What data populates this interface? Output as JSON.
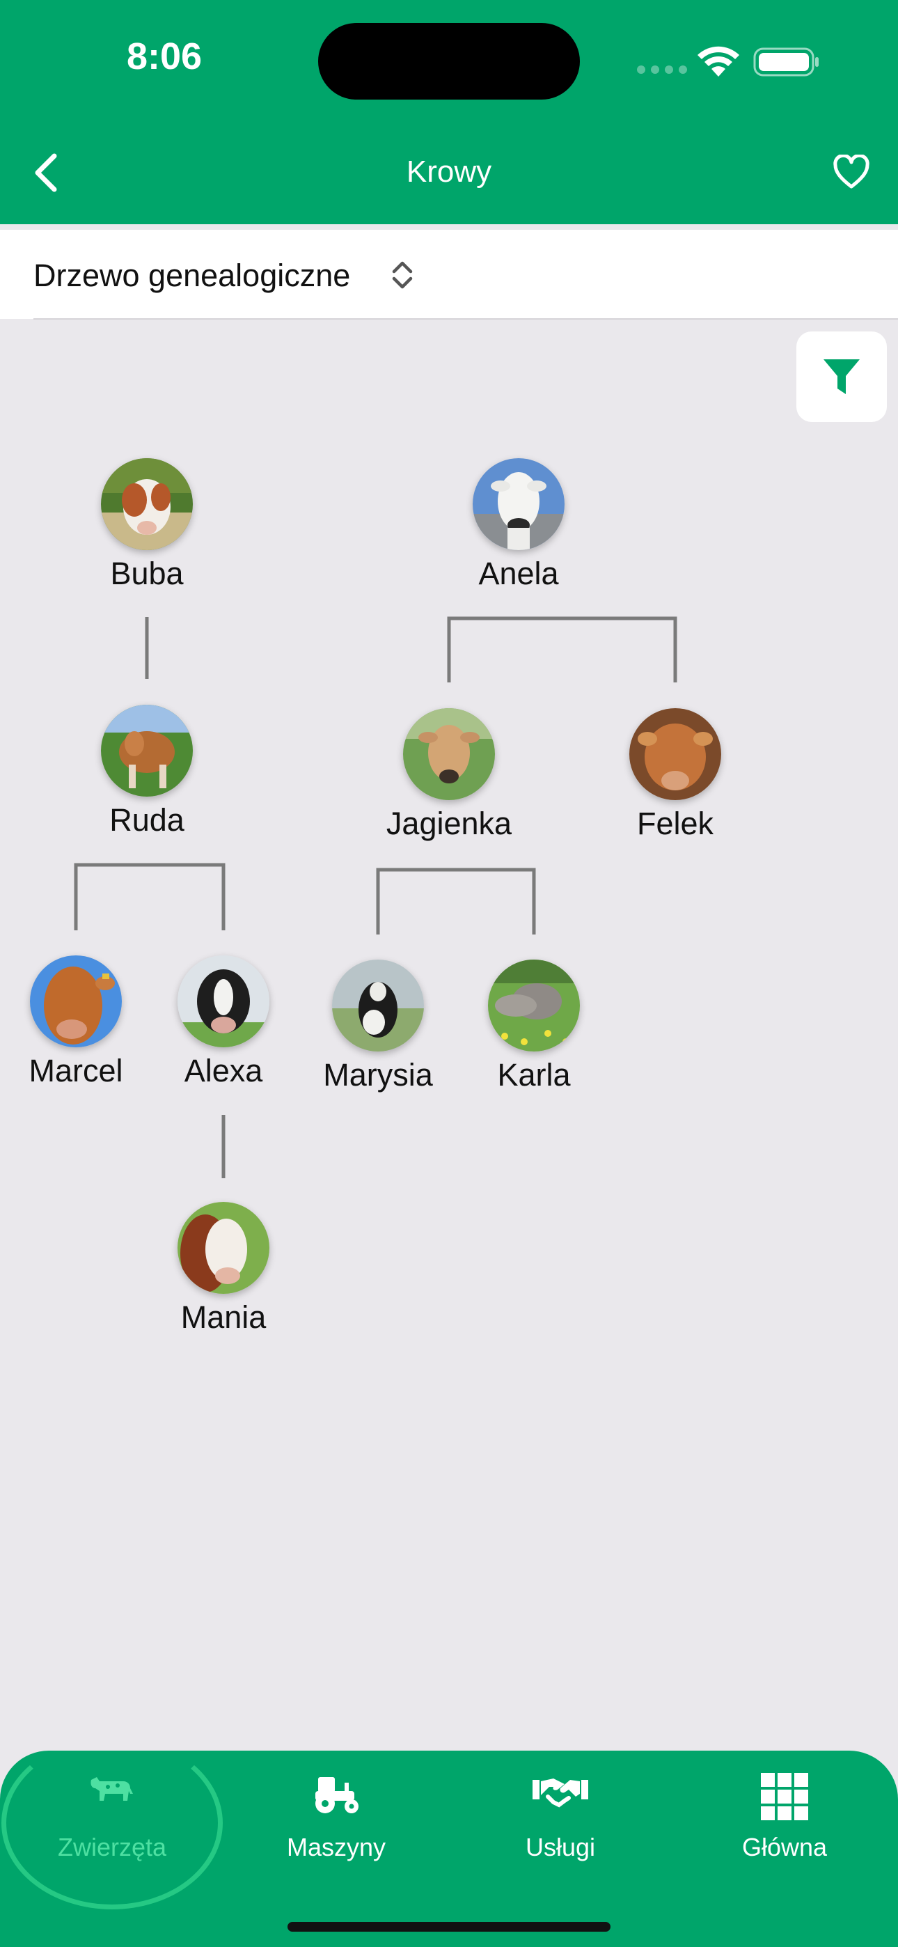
{
  "status_bar": {
    "time": "8:06"
  },
  "nav": {
    "title": "Krowy"
  },
  "section_selector": {
    "label": "Drzewo genealogiczne"
  },
  "colors": {
    "brand": "#00A56A",
    "active_tab": "#4EE0A2",
    "background": "#EAE8EC",
    "connector": "#7A7A7A"
  },
  "tree": {
    "nodes": [
      {
        "id": "buba",
        "name": "Buba",
        "photo": "cow-brown-white"
      },
      {
        "id": "anela",
        "name": "Anela",
        "photo": "cow-white"
      },
      {
        "id": "ruda",
        "name": "Ruda",
        "photo": "cow-brown"
      },
      {
        "id": "jagienka",
        "name": "Jagienka",
        "photo": "cow-light-brown"
      },
      {
        "id": "felek",
        "name": "Felek",
        "photo": "bull-brown"
      },
      {
        "id": "marcel",
        "name": "Marcel",
        "photo": "bull-red"
      },
      {
        "id": "alexa",
        "name": "Alexa",
        "photo": "cow-black-white"
      },
      {
        "id": "marysia",
        "name": "Marysia",
        "photo": "cow-black-white-field"
      },
      {
        "id": "karla",
        "name": "Karla",
        "photo": "cow-grey-flowers"
      },
      {
        "id": "mania",
        "name": "Mania",
        "photo": "cow-red-white"
      }
    ],
    "relations": [
      {
        "parent": "buba",
        "children": [
          "ruda"
        ]
      },
      {
        "parent": "anela",
        "children": [
          "jagienka",
          "felek"
        ]
      },
      {
        "parent": "ruda",
        "children": [
          "marcel",
          "alexa"
        ]
      },
      {
        "parent": "jagienka",
        "children": [
          "marysia",
          "karla"
        ]
      },
      {
        "parent": "alexa",
        "children": [
          "mania"
        ]
      }
    ]
  },
  "tabbar": {
    "tabs": [
      {
        "label": "Zwierzęta",
        "icon": "cow-icon",
        "active": true
      },
      {
        "label": "Maszyny",
        "icon": "tractor-icon",
        "active": false
      },
      {
        "label": "Usługi",
        "icon": "handshake-icon",
        "active": false
      },
      {
        "label": "Główna",
        "icon": "grid-icon",
        "active": false
      }
    ]
  }
}
